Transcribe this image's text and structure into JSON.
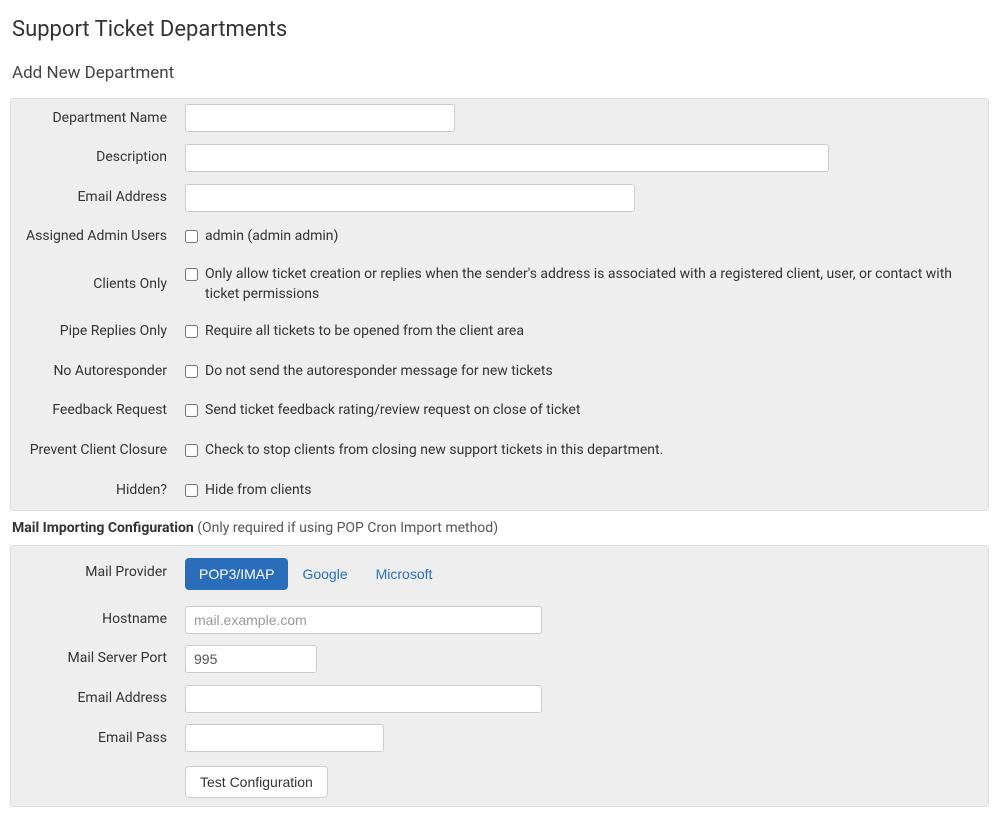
{
  "page": {
    "title": "Support Ticket Departments",
    "section": "Add New Department"
  },
  "form": {
    "department_name": {
      "label": "Department Name",
      "value": ""
    },
    "description": {
      "label": "Description",
      "value": ""
    },
    "email_address": {
      "label": "Email Address",
      "value": ""
    },
    "assigned_admins": {
      "label": "Assigned Admin Users",
      "option": "admin (admin admin)"
    },
    "clients_only": {
      "label": "Clients Only",
      "desc": "Only allow ticket creation or replies when the sender's address is associated with a registered client, user, or contact with ticket permissions"
    },
    "pipe_replies": {
      "label": "Pipe Replies Only",
      "desc": "Require all tickets to be opened from the client area"
    },
    "no_autoresponder": {
      "label": "No Autoresponder",
      "desc": "Do not send the autoresponder message for new tickets"
    },
    "feedback_request": {
      "label": "Feedback Request",
      "desc": "Send ticket feedback rating/review request on close of ticket"
    },
    "prevent_closure": {
      "label": "Prevent Client Closure",
      "desc": "Check to stop clients from closing new support tickets in this department."
    },
    "hidden": {
      "label": "Hidden?",
      "desc": "Hide from clients"
    }
  },
  "mail": {
    "heading": "Mail Importing Configuration",
    "heading_sub": "(Only required if using POP Cron Import method)",
    "provider_label": "Mail Provider",
    "tabs": [
      "POP3/IMAP",
      "Google",
      "Microsoft"
    ],
    "hostname": {
      "label": "Hostname",
      "placeholder": "mail.example.com",
      "value": ""
    },
    "port": {
      "label": "Mail Server Port",
      "value": "995"
    },
    "email": {
      "label": "Email Address",
      "value": ""
    },
    "pass": {
      "label": "Email Pass",
      "value": ""
    },
    "test_btn": "Test Configuration"
  }
}
